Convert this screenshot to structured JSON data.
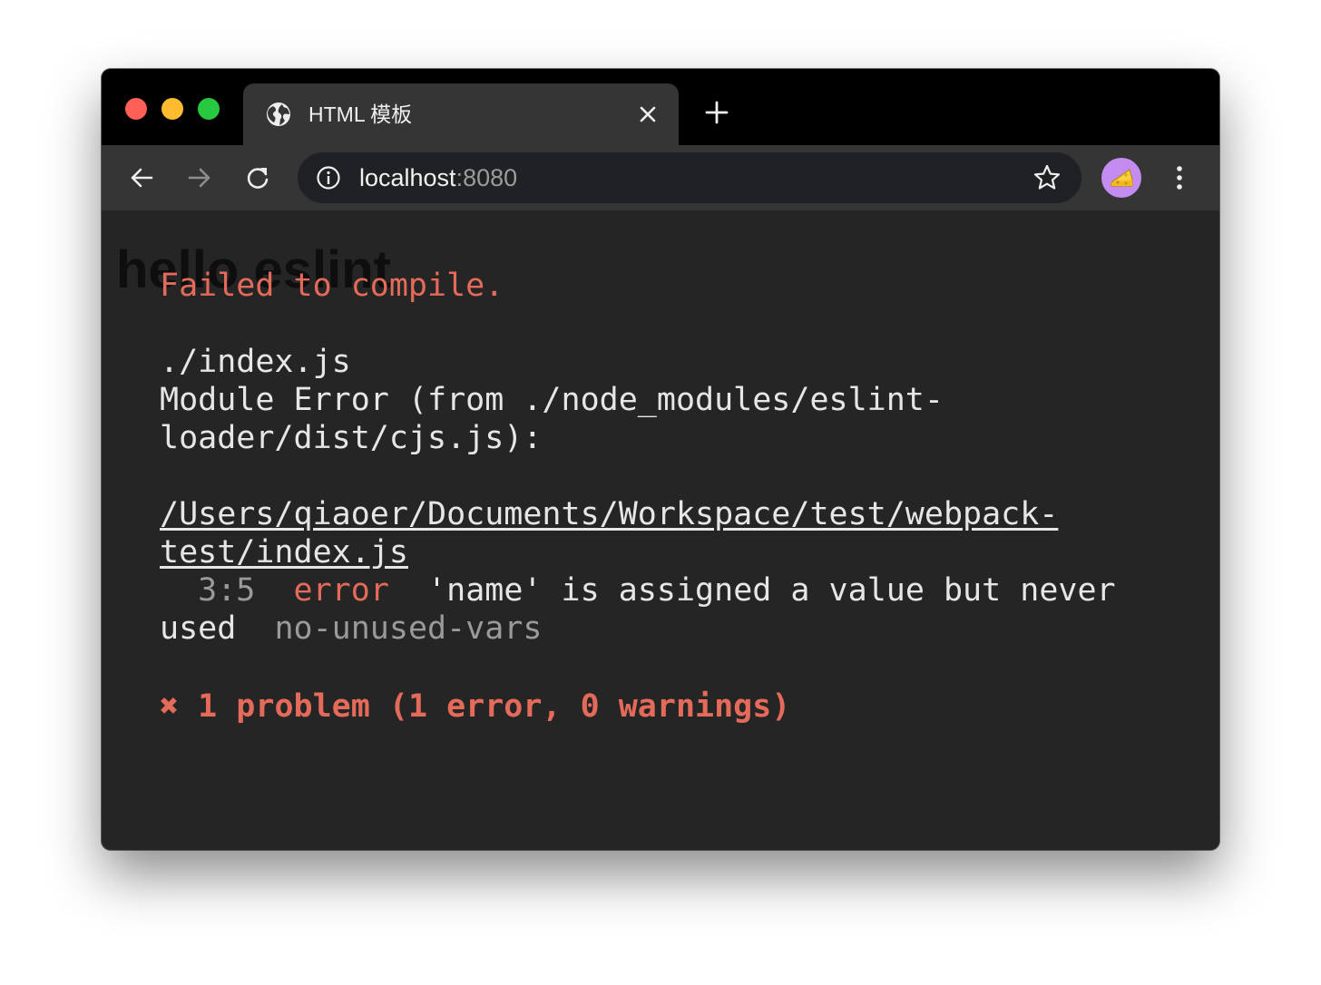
{
  "window": {
    "tab": {
      "title": "HTML 模板"
    },
    "address_bar": {
      "host": "localhost",
      "port": ":8080"
    }
  },
  "page": {
    "heading": "hello eslint"
  },
  "error_overlay": {
    "title": "Failed to compile.",
    "file": "./index.js",
    "module_error_line1": "Module Error (from ./node_modules/eslint-",
    "module_error_line2": "loader/dist/cjs.js):",
    "path_line1": "/Users/qiaoer/Documents/Workspace/test/webpack-",
    "path_line2": "test/index.js",
    "problem": {
      "location": "3:5",
      "severity": "error",
      "message_line1": "'name' is assigned a value but never",
      "message_line2": "used",
      "rule": "no-unused-vars"
    },
    "summary_icon": "✖",
    "summary": "1 problem (1 error, 0 warnings)"
  },
  "icons": {
    "tab_favicon": "globe-icon",
    "tab_close": "close-icon",
    "new_tab": "plus-icon",
    "back": "arrow-left-icon",
    "forward": "arrow-right-icon",
    "reload": "reload-icon",
    "site_info": "info-icon",
    "bookmark": "star-icon",
    "profile": "cheese-avatar-icon",
    "menu": "kebab-menu-icon"
  },
  "colors": {
    "error_red": "#e46a5a",
    "overlay_text": "#e6e6e6",
    "dim_text": "#9a9a9a",
    "background": "#252525"
  }
}
